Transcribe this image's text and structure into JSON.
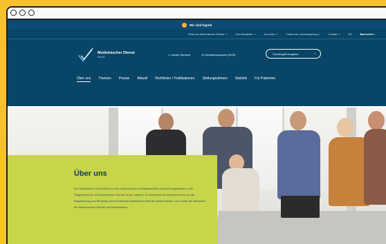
{
  "announcement": {
    "text": "Wir sind hyped"
  },
  "meta": [
    "Portal der Medizinischen Dienste ↗",
    "Zum Newsletter ↗",
    "Job-Index ↗",
    "Clowns der Landesregierung ↗",
    "Kontakt ↗",
    "DE",
    "Barrierefrei ›"
  ],
  "brand": {
    "line1": "Medizinischer Dienst",
    "line2": "Bund"
  },
  "quick": [
    "◐ Leichte Sprache",
    "◎ Gebärdensprache (DGS)"
  ],
  "search": {
    "placeholder": "Suchbegriff eingeben",
    "icon": "search-icon"
  },
  "nav": [
    "Über uns",
    "Themen",
    "Presse",
    "Aktuell",
    "Richtlinien / Publikationen",
    "Stellungnahmen",
    "Statistik",
    "Für Patienten"
  ],
  "hero": {
    "title": "Über uns",
    "text": "Der Medizinische Dienst Bund ist eine medizinische und pflegefachliche Expertenorganisation in der Trägerschaft der 15 Medizinischen Dienste in den Ländern. Er koordiniert die fachliche Arbeit, um die Begutachtung und Beratung nach bundesweit einheitlichen Kriterien sicherzustellen, und vertritt die Interessen der Medizinischen Dienste auf Bundesebene."
  },
  "colors": {
    "brand_blue": "#084566",
    "hero_green": "#c8d44a",
    "outer_yellow": "#f6c12d"
  }
}
